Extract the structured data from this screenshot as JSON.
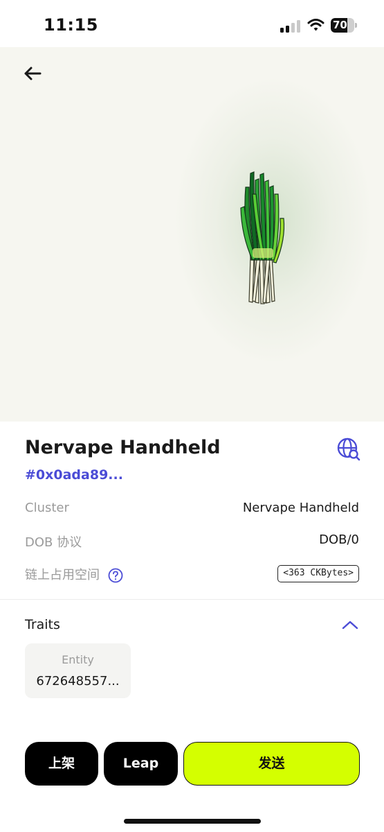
{
  "status_bar": {
    "time": "11:15",
    "battery": "70",
    "battery_level": 0.7
  },
  "header": {
    "back_icon": "arrow-left-icon"
  },
  "nft": {
    "title": "Nervape Handheld",
    "id": "#0x0ada89...",
    "explorer_icon": "globe-search-icon"
  },
  "details": {
    "rows": [
      {
        "label": "Cluster",
        "value": "Nervape Handheld"
      },
      {
        "label": "DOB 协议",
        "value": "DOB/0"
      },
      {
        "label": "链上占用空间",
        "value": "<363 CKBytes>"
      }
    ]
  },
  "traits": {
    "label": "Traits",
    "items": [
      {
        "name": "Entity",
        "value": "672648557..."
      }
    ]
  },
  "actions": {
    "list_label": "上架",
    "leap_label": "Leap",
    "send_label": "发送"
  },
  "colors": {
    "accent": "#4b4cd6",
    "send_button": "#d4ff00",
    "hero_bg": "#f6f6f0"
  }
}
